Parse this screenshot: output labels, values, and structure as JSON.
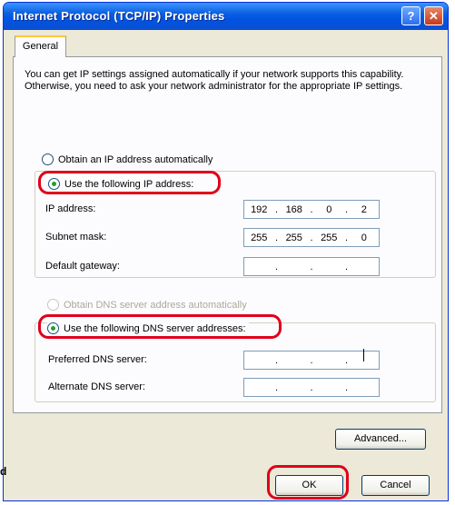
{
  "window": {
    "title": "Internet Protocol (TCP/IP) Properties",
    "help_glyph": "?",
    "close_glyph": "✕"
  },
  "tabs": [
    {
      "label": "General"
    }
  ],
  "description": "You can get IP settings assigned automatically if your network supports this capability. Otherwise, you need to ask your network administrator for the appropriate IP settings.",
  "ip_section": {
    "obtain_auto_label": "Obtain an IP address automatically",
    "use_following_label": "Use the following IP address:",
    "ip_address_label": "IP address:",
    "ip_address": [
      "192",
      "168",
      "0",
      "2"
    ],
    "subnet_label": "Subnet mask:",
    "subnet": [
      "255",
      "255",
      "255",
      "0"
    ],
    "gateway_label": "Default gateway:",
    "gateway": [
      "",
      "",
      "",
      ""
    ]
  },
  "dns_section": {
    "obtain_auto_label": "Obtain DNS server address automatically",
    "use_following_label": "Use the following DNS server addresses:",
    "preferred_label": "Preferred DNS server:",
    "preferred": [
      "",
      "",
      "",
      ""
    ],
    "alternate_label": "Alternate DNS server:",
    "alternate": [
      "",
      "",
      "",
      ""
    ]
  },
  "buttons": {
    "advanced": "Advanced...",
    "ok": "OK",
    "cancel": "Cancel"
  },
  "outside_text": "d",
  "colors": {
    "highlight": "#e0001a",
    "titlebar": "#0054e3",
    "radio_dot": "#21a121"
  }
}
